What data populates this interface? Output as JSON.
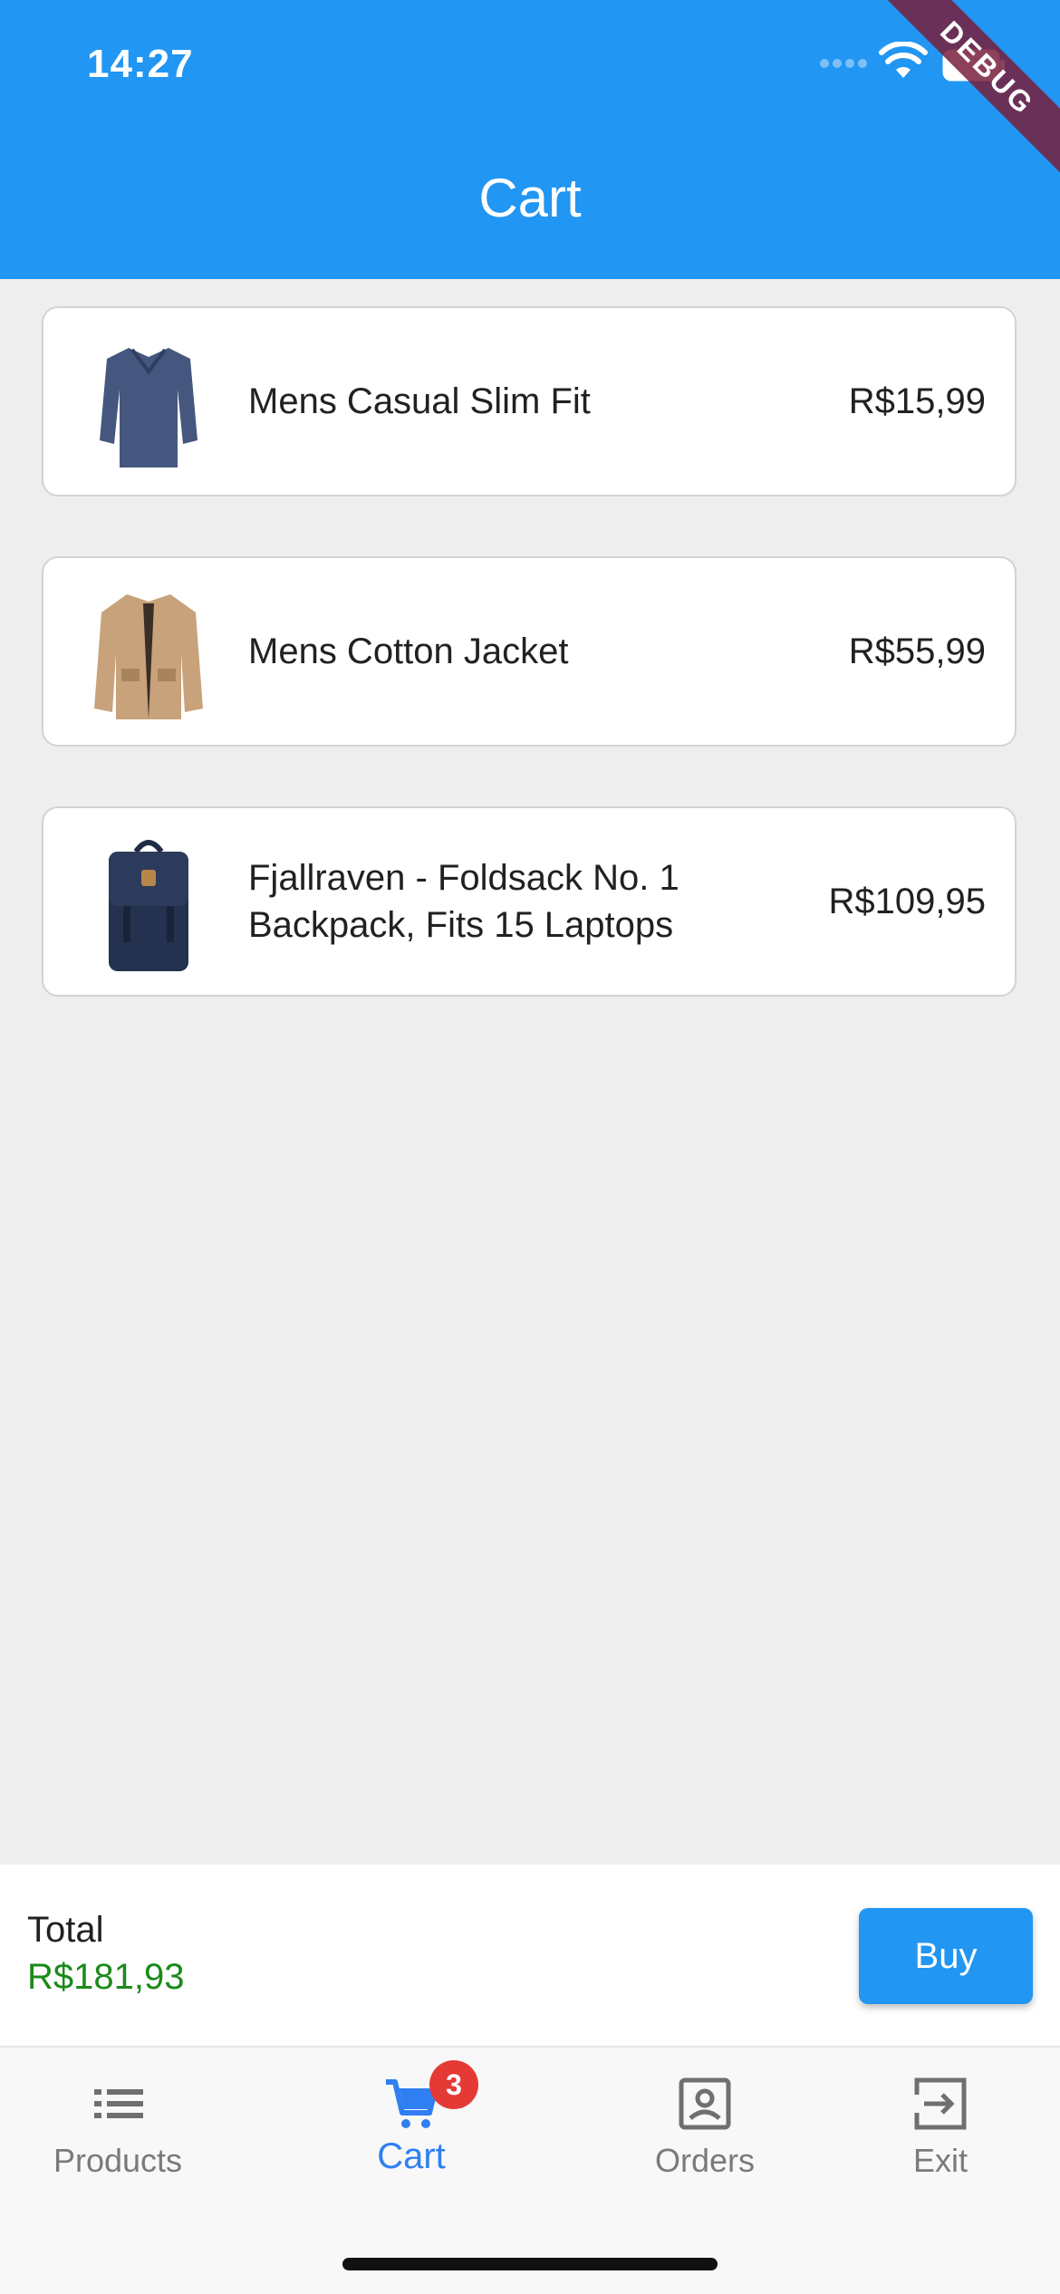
{
  "status_bar": {
    "time": "14:27"
  },
  "debug_banner": "DEBUG",
  "app_bar": {
    "title": "Cart"
  },
  "cart_items": [
    {
      "name": "Mens Casual Slim Fit",
      "price": "R$15,99",
      "image": "shirt-image"
    },
    {
      "name": "Mens Cotton Jacket",
      "price": "R$55,99",
      "image": "jacket-image"
    },
    {
      "name": "Fjallraven - Foldsack No. 1 Backpack, Fits 15 Laptops",
      "price": "R$109,95",
      "image": "backpack-image"
    }
  ],
  "total": {
    "label": "Total",
    "value": "R$181,93",
    "color": "#1b8a1b"
  },
  "buy_button": {
    "label": "Buy"
  },
  "bottom_nav": {
    "items": [
      {
        "label": "Products",
        "icon": "list-icon",
        "active": false
      },
      {
        "label": "Cart",
        "icon": "cart-icon",
        "active": true,
        "badge": "3"
      },
      {
        "label": "Orders",
        "icon": "portrait-icon",
        "active": false
      },
      {
        "label": "Exit",
        "icon": "exit-icon",
        "active": false
      }
    ]
  },
  "colors": {
    "primary": "#2196f3",
    "badge": "#e53935",
    "active_nav": "#2f7ff2"
  }
}
